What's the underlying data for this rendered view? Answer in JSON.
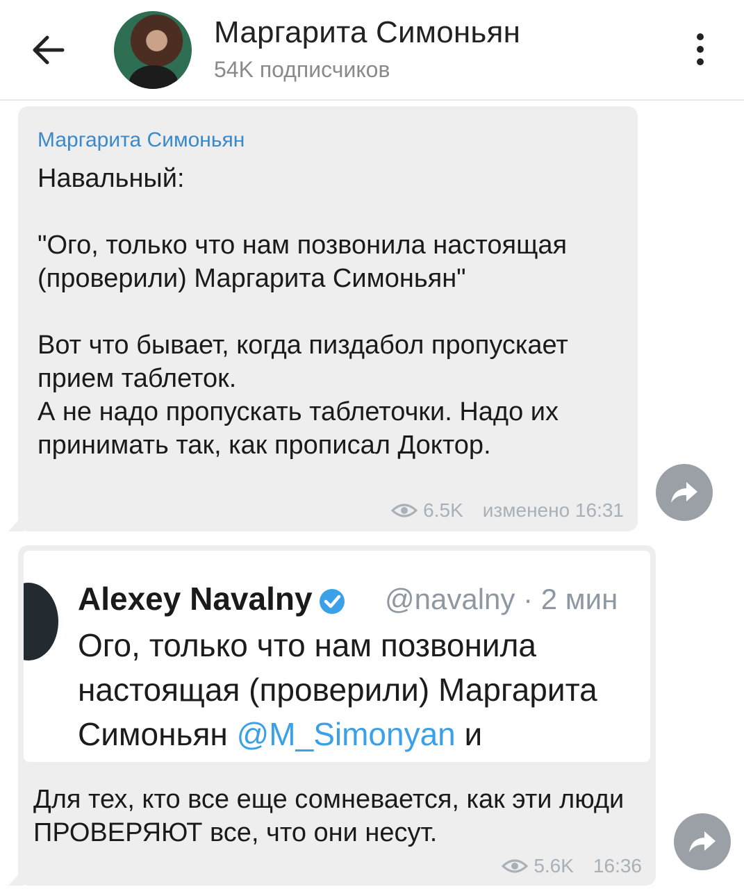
{
  "header": {
    "back_icon": "arrow-left-icon",
    "title": "Маргарита Симоньян",
    "subtitle": "54K подписчиков",
    "menu_icon": "more-vertical-icon"
  },
  "messages": [
    {
      "author": "Маргарита Симоньян",
      "text": "Навальный:\n\n\"Ого, только что нам позвонила настоящая (проверили) Маргарита Симоньян\"\n\nВот что бывает, когда пиздабол пропускает прием таблеток.\nА не надо пропускать таблеточки. Надо их принимать так, как прописал Доктор.",
      "views": "6.5K",
      "edited": "изменено 16:31",
      "forward_icon": "share-forward-icon"
    },
    {
      "tweet": {
        "name": "Alexey Navalny",
        "handle": "@navalny · 2 мин",
        "line1": "Ого, только что нам позвонила",
        "line2": "настоящая (проверили) Маргарита",
        "line3_prefix": "Симоньян ",
        "mention": "@M_Simonyan",
        "line3_suffix": " и"
      },
      "caption": "Для тех, кто все еще сомневается, как эти люди ПРОВЕРЯЮТ все, что они несут.",
      "views": "5.6K",
      "time": "16:36",
      "forward_icon": "share-forward-icon"
    }
  ],
  "colors": {
    "accent": "#3a89c9",
    "bubble": "#eeeeee",
    "meta": "#a8b0b8",
    "forward_button": "#9aa0a6"
  }
}
